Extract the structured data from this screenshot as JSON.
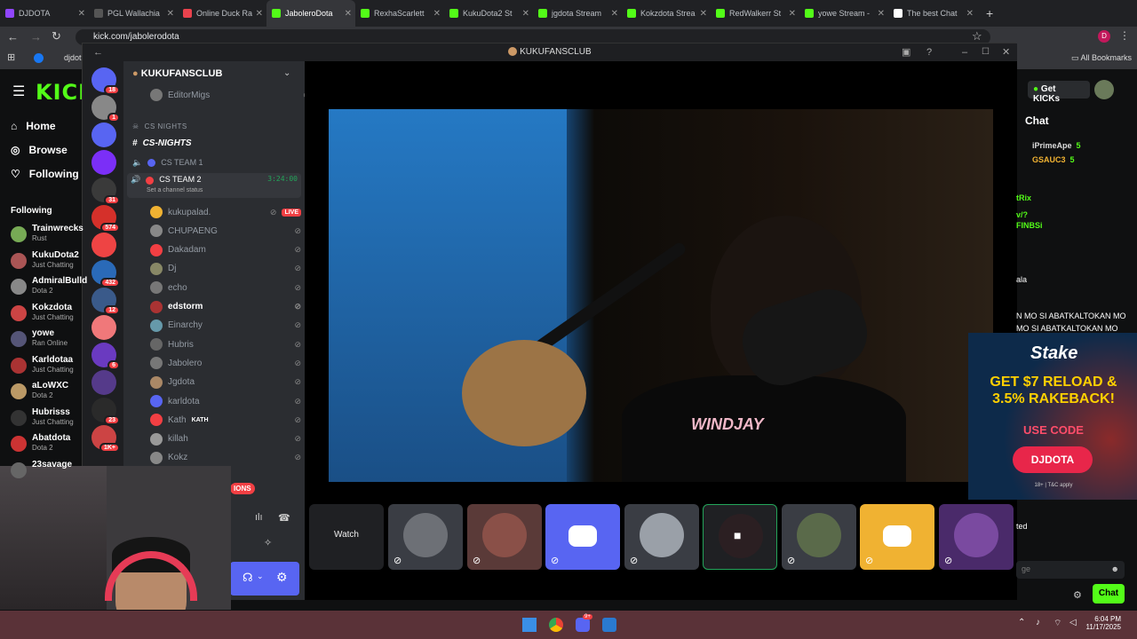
{
  "browser": {
    "tabs": [
      {
        "label": "DJDOTA",
        "color": "#9146ff"
      },
      {
        "label": "PGL Wallachia",
        "color": "#555"
      },
      {
        "label": "Online Duck Ra",
        "color": "#e9424d"
      },
      {
        "label": "JaboleroDota",
        "color": "#53fc18",
        "active": true
      },
      {
        "label": "RexhaScarlett",
        "color": "#53fc18"
      },
      {
        "label": "KukuDota2 St",
        "color": "#53fc18"
      },
      {
        "label": "jgdota Stream",
        "color": "#53fc18"
      },
      {
        "label": "Kokzdota Strea",
        "color": "#53fc18"
      },
      {
        "label": "RedWalkerr St",
        "color": "#53fc18"
      },
      {
        "label": "yowe Stream -",
        "color": "#53fc18"
      },
      {
        "label": "The best Chat",
        "color": "#fff"
      }
    ],
    "url": "kick.com/jabolerodota",
    "bookmarks": "All Bookmarks",
    "bookmark_item": "djdot"
  },
  "kick": {
    "logo": "KICK",
    "nav": [
      {
        "label": "Home",
        "icon": "home-icon"
      },
      {
        "label": "Browse",
        "icon": "compass-icon"
      },
      {
        "label": "Following",
        "icon": "heart-icon"
      }
    ],
    "following_header": "Following",
    "following": [
      {
        "name": "Trainwrecks",
        "status": "Rust",
        "color": "#7a5"
      },
      {
        "name": "KukuDota2",
        "status": "Just Chatting",
        "color": "#a55"
      },
      {
        "name": "AdmiralBulld",
        "status": "Dota 2",
        "color": "#888"
      },
      {
        "name": "Kokzdota",
        "status": "Just Chatting",
        "color": "#c44"
      },
      {
        "name": "yowe",
        "status": "Ran Online",
        "color": "#557"
      },
      {
        "name": "Karldotaa",
        "status": "Just Chatting",
        "color": "#a33"
      },
      {
        "name": "aLoWXC",
        "status": "Dota 2",
        "color": "#b96"
      },
      {
        "name": "Hubrisss",
        "status": "Just Chatting",
        "color": "#333"
      },
      {
        "name": "Abatdota",
        "status": "Dota 2",
        "color": "#c33"
      },
      {
        "name": "23savage",
        "status": "",
        "color": "#666"
      }
    ],
    "get_kicks": "Get KICKs",
    "chat_title": "Chat",
    "chat_users": [
      {
        "name": "iPrimeApe",
        "n": "5"
      },
      {
        "name": "GSAUC3",
        "n": "5"
      }
    ],
    "chat_lines": [
      "tRix",
      "v/?",
      "FINBSi",
      "ala",
      "N MO SI ABATKALTOKAN MO",
      "MO SI ABATKALTOKAN MO",
      "ted"
    ],
    "chat_input_placeholder": "ge",
    "chat_button": "Chat"
  },
  "ad": {
    "brand": "Stake",
    "headline": "GET $7 RELOAD & 3.5% RAKEBACK!",
    "use_code": "USE CODE",
    "code": "DJDOTA",
    "fine": "18+ | T&C apply"
  },
  "discord": {
    "window_title": "KUKUFANSCLUB",
    "server_name": "KUKUFANSCLUB",
    "guild_badges": [
      "18",
      "1",
      "31",
      "574",
      "432",
      "12",
      "6",
      "23",
      "1K+"
    ],
    "top_member": "EditorMigs",
    "category": "CS NIGHTS",
    "text_channel": "CS-NIGHTS",
    "voice_channels": [
      {
        "name": "CS TEAM 1"
      },
      {
        "name": "CS TEAM 2",
        "timer": "3:24:00",
        "status": "Set a channel status"
      }
    ],
    "members": [
      {
        "name": "kukupalad.",
        "live": "LIVE",
        "color": "#f0b232"
      },
      {
        "name": "CHUPAENG",
        "color": "#888"
      },
      {
        "name": "Dakadam",
        "color": "#f23f43"
      },
      {
        "name": "Dj",
        "color": "#886"
      },
      {
        "name": "echo",
        "color": "#777"
      },
      {
        "name": "edstorm",
        "color": "#a33",
        "bold": true
      },
      {
        "name": "Einarchy",
        "color": "#69a"
      },
      {
        "name": "Hubris",
        "color": "#666"
      },
      {
        "name": "Jabolero",
        "color": "#777"
      },
      {
        "name": "Jgdota",
        "color": "#a86"
      },
      {
        "name": "karldota",
        "color": "#5865f2"
      },
      {
        "name": "Kath",
        "tag": "KATH",
        "color": "#f23f43"
      },
      {
        "name": "killah",
        "color": "#999"
      },
      {
        "name": "Kokz",
        "color": "#888"
      }
    ],
    "watch_label": "Watch",
    "partial_label": "IONS"
  },
  "stream": {
    "shirt_text": "WINDJAY"
  },
  "taskbar": {
    "time": "6:04 PM",
    "date": "11/17/2025",
    "badge": "9+"
  }
}
